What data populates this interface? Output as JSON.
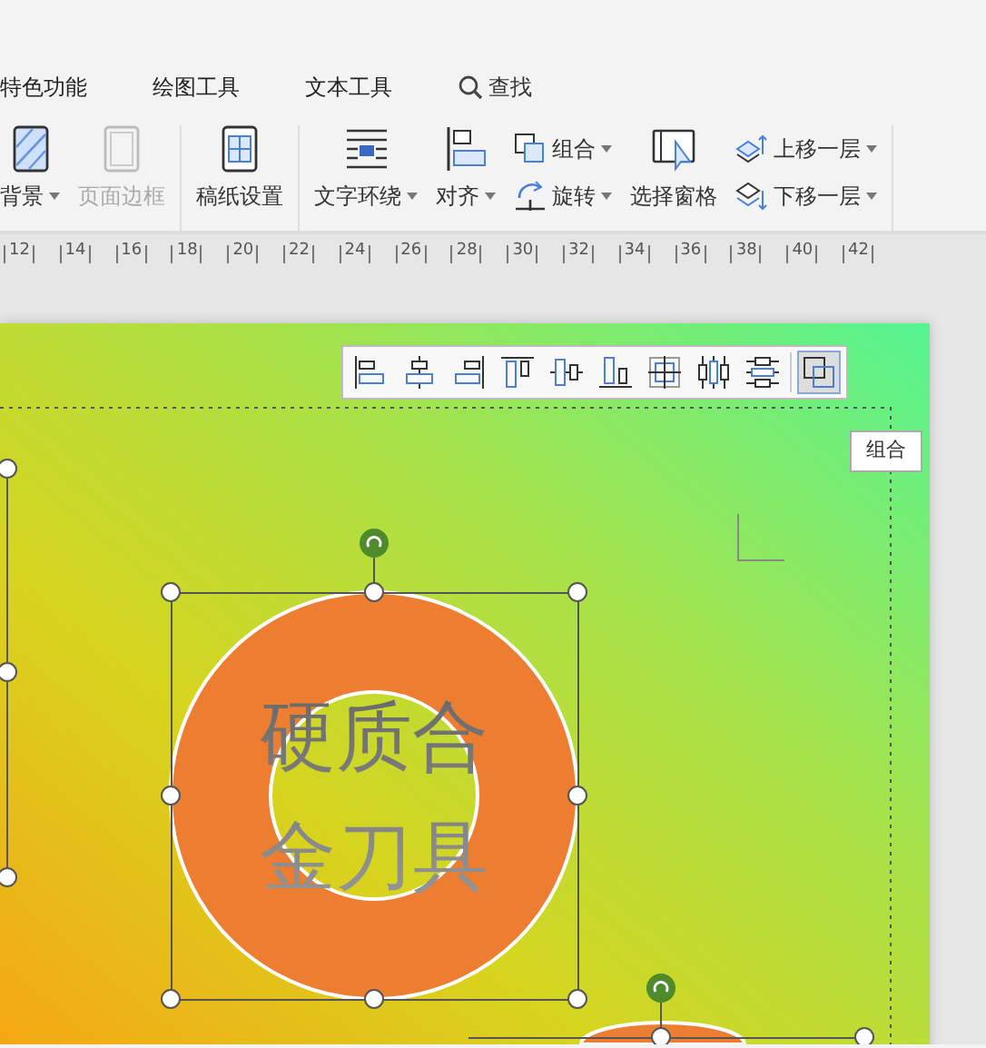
{
  "menu_tabs": [
    {
      "label": "特色功能"
    },
    {
      "label": "绘图工具"
    },
    {
      "label": "文本工具"
    }
  ],
  "search": {
    "label": "查找"
  },
  "ribbon_groups": [
    [
      {
        "kind": "large",
        "label": "背景",
        "dropdown": true,
        "disabled": false
      },
      {
        "kind": "large",
        "label": "页面边框",
        "dropdown": false,
        "disabled": true
      }
    ],
    [
      {
        "kind": "large",
        "label": "稿纸设置",
        "dropdown": false,
        "disabled": false
      }
    ],
    [
      {
        "kind": "large",
        "label": "文字环绕",
        "dropdown": true,
        "disabled": false
      },
      {
        "kind": "large",
        "label": "对齐",
        "dropdown": true,
        "disabled": false
      },
      {
        "kind": "stack",
        "items": [
          {
            "label": "组合",
            "dropdown": true
          },
          {
            "label": "旋转",
            "dropdown": true
          }
        ]
      },
      {
        "kind": "large",
        "label": "选择窗格",
        "dropdown": false,
        "disabled": false
      },
      {
        "kind": "stack",
        "items": [
          {
            "label": "上移一层",
            "dropdown": true
          },
          {
            "label": "下移一层",
            "dropdown": true
          }
        ]
      }
    ]
  ],
  "ruler": [
    "12",
    "14",
    "16",
    "18",
    "20",
    "22",
    "24",
    "26",
    "28",
    "30",
    "32",
    "34",
    "36",
    "38",
    "40",
    "42"
  ],
  "align_toolbar": [
    {
      "selected": false
    },
    {
      "selected": false
    },
    {
      "selected": false
    },
    {
      "selected": false
    },
    {
      "selected": false
    },
    {
      "selected": false
    },
    {
      "selected": false
    },
    {
      "selected": false
    },
    {
      "selected": false
    },
    {
      "selected": true
    }
  ],
  "tooltip": "组合",
  "shape_text": [
    "硬质合",
    "金刀具"
  ]
}
